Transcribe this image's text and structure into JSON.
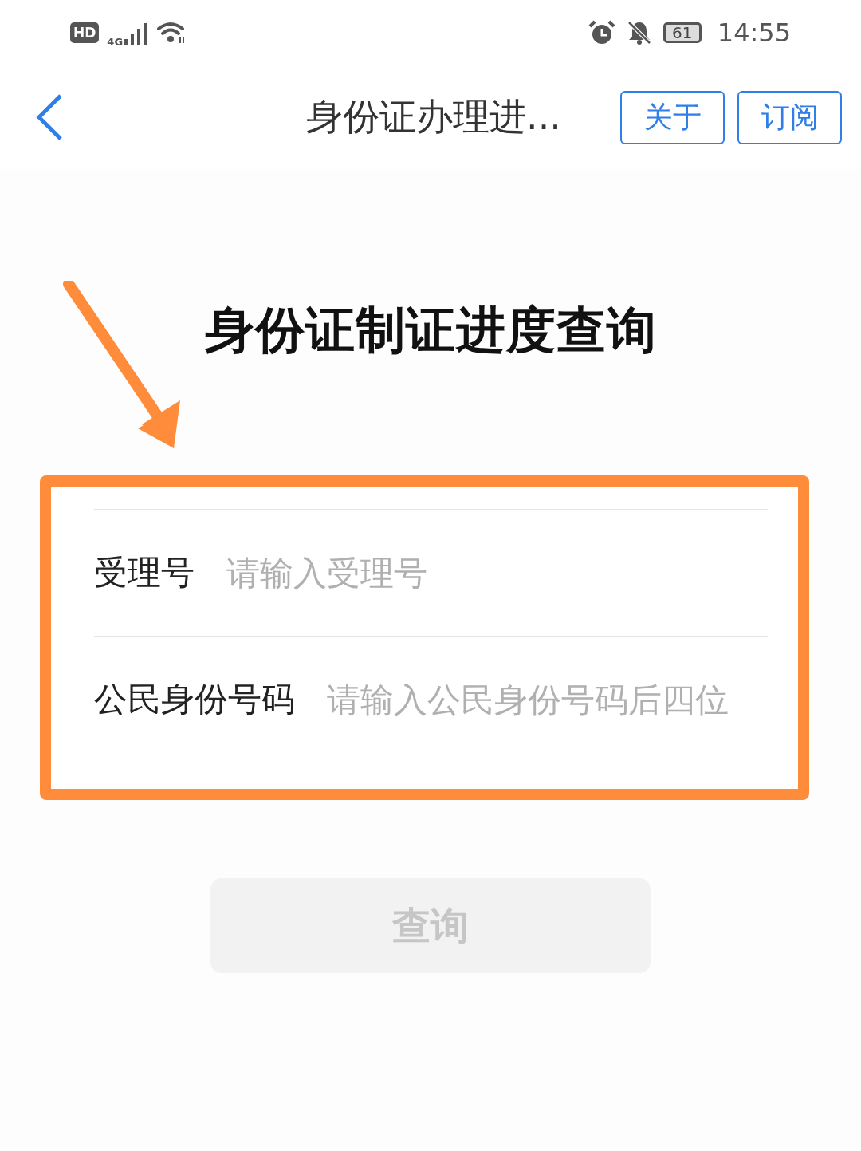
{
  "status_bar": {
    "hd_badge": "HD",
    "network": "4G",
    "battery": "61",
    "time": "14:55"
  },
  "nav_bar": {
    "title": "身份证办理进...",
    "buttons": [
      {
        "label": "关于"
      },
      {
        "label": "订阅"
      }
    ]
  },
  "heading": "身份证制证进度查询",
  "form": {
    "fields": [
      {
        "label": "受理号",
        "placeholder": "请输入受理号"
      },
      {
        "label": "公民身份号码",
        "placeholder": "请输入公民身份号码后四位"
      }
    ]
  },
  "submit": {
    "label": "查询",
    "disabled": true
  }
}
